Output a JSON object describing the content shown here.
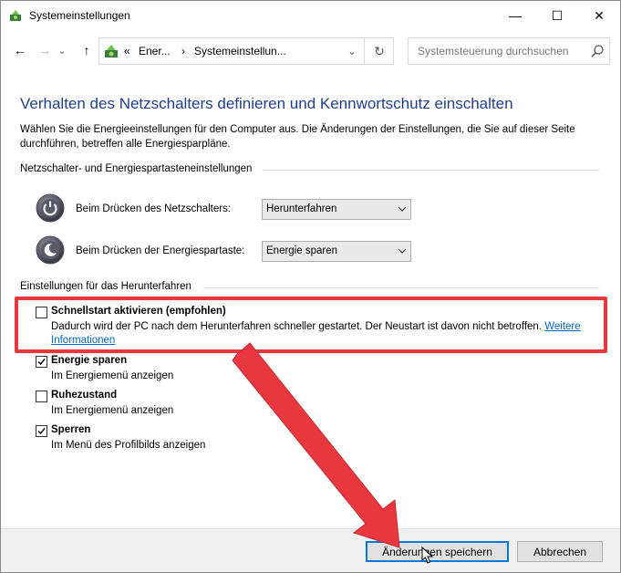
{
  "window": {
    "title": "Systemeinstellungen"
  },
  "titlebar": {
    "minimize_glyph": "—",
    "maximize_glyph": "☐",
    "close_glyph": "✕"
  },
  "nav": {
    "back_glyph": "←",
    "forward_glyph": "→",
    "up_glyph": "↑",
    "dropdown_glyph": "⌄"
  },
  "address": {
    "overflow": "«",
    "crumbs": [
      "Ener...",
      "Systemeinstellun..."
    ],
    "separator": "›",
    "dropdown_glyph": "⌄",
    "refresh_glyph": "↻"
  },
  "search": {
    "placeholder": "Systemsteuerung durchsuchen"
  },
  "content": {
    "heading": "Verhalten des Netzschalters definieren und Kennwortschutz einschalten",
    "intro": "Wählen Sie die Energieeinstellungen für den Computer aus. Die Änderungen der Einstellungen, die Sie auf dieser Seite durchführen, betreffen alle Energiesparpläne."
  },
  "power_section": {
    "title": "Netzschalter- und Energiespartasteneinstellungen",
    "rows": [
      {
        "label": "Beim Drücken des Netzschalters:",
        "value": "Herunterfahren",
        "icon": "power-button-icon"
      },
      {
        "label": "Beim Drücken der Energiespartaste:",
        "value": "Energie sparen",
        "icon": "sleep-button-icon"
      }
    ]
  },
  "shutdown_section": {
    "title": "Einstellungen für das Herunterfahren",
    "options": [
      {
        "title": "Schnellstart aktivieren (empfohlen)",
        "desc": "Dadurch wird der PC nach dem Herunterfahren schneller gestartet. Der Neustart ist davon nicht betroffen.",
        "link1": "Weitere",
        "link2": "Informationen",
        "checked": false
      },
      {
        "title": "Energie sparen",
        "desc": "Im Energiemenü anzeigen",
        "checked": true
      },
      {
        "title": "Ruhezustand",
        "desc": "Im Energiemenü anzeigen",
        "checked": false
      },
      {
        "title": "Sperren",
        "desc": "Im Menü des Profilbilds anzeigen",
        "checked": true
      }
    ]
  },
  "buttons": {
    "save": "Änderungen speichern",
    "cancel": "Abbrechen"
  },
  "colors": {
    "heading": "#1e3e8f",
    "highlight": "#e8373e",
    "link": "#0066cc",
    "primary_border": "#0078d7"
  }
}
